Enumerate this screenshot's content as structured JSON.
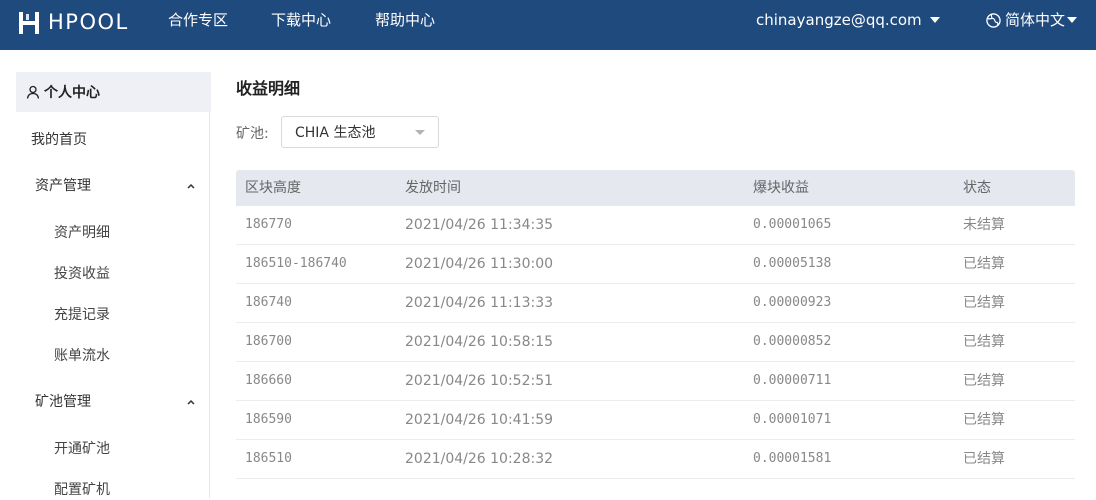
{
  "header": {
    "logo_text": "HPOOL",
    "nav": [
      {
        "label": "合作专区"
      },
      {
        "label": "下载中心"
      },
      {
        "label": "帮助中心"
      }
    ],
    "user_email": "chinayangze@qq.com",
    "language": "简体中文"
  },
  "sidebar": {
    "header": "个人中心",
    "home": "我的首页",
    "groups": [
      {
        "label": "资产管理",
        "items": [
          "资产明细",
          "投资收益",
          "充提记录",
          "账单流水"
        ]
      },
      {
        "label": "矿池管理",
        "items": [
          "开通矿池",
          "配置矿机"
        ]
      }
    ]
  },
  "main": {
    "title": "收益明细",
    "pool_label": "矿池:",
    "pool_selected": "CHIA 生态池",
    "columns": [
      "区块高度",
      "发放时间",
      "爆块收益",
      "状态"
    ],
    "rows": [
      {
        "height": "186770",
        "time": "2021/04/26 11:34:35",
        "reward": "0.00001065",
        "status": "未结算"
      },
      {
        "height": "186510-186740",
        "time": "2021/04/26 11:30:00",
        "reward": "0.00005138",
        "status": "已结算"
      },
      {
        "height": "186740",
        "time": "2021/04/26 11:13:33",
        "reward": "0.00000923",
        "status": "已结算"
      },
      {
        "height": "186700",
        "time": "2021/04/26 10:58:15",
        "reward": "0.00000852",
        "status": "已结算"
      },
      {
        "height": "186660",
        "time": "2021/04/26 10:52:51",
        "reward": "0.00000711",
        "status": "已结算"
      },
      {
        "height": "186590",
        "time": "2021/04/26 10:41:59",
        "reward": "0.00001071",
        "status": "已结算"
      },
      {
        "height": "186510",
        "time": "2021/04/26 10:28:32",
        "reward": "0.00001581",
        "status": "已结算"
      }
    ]
  },
  "colors": {
    "topbar": "#1f4a7d",
    "table_header": "#e5e8ef",
    "sidebar_active": "#eef0f6"
  },
  "icons": {
    "logo": "hpool-logo-icon",
    "dropdown": "caret-down-icon",
    "language": "globe-icon",
    "user": "user-icon",
    "collapse": "chevron-up-icon"
  }
}
